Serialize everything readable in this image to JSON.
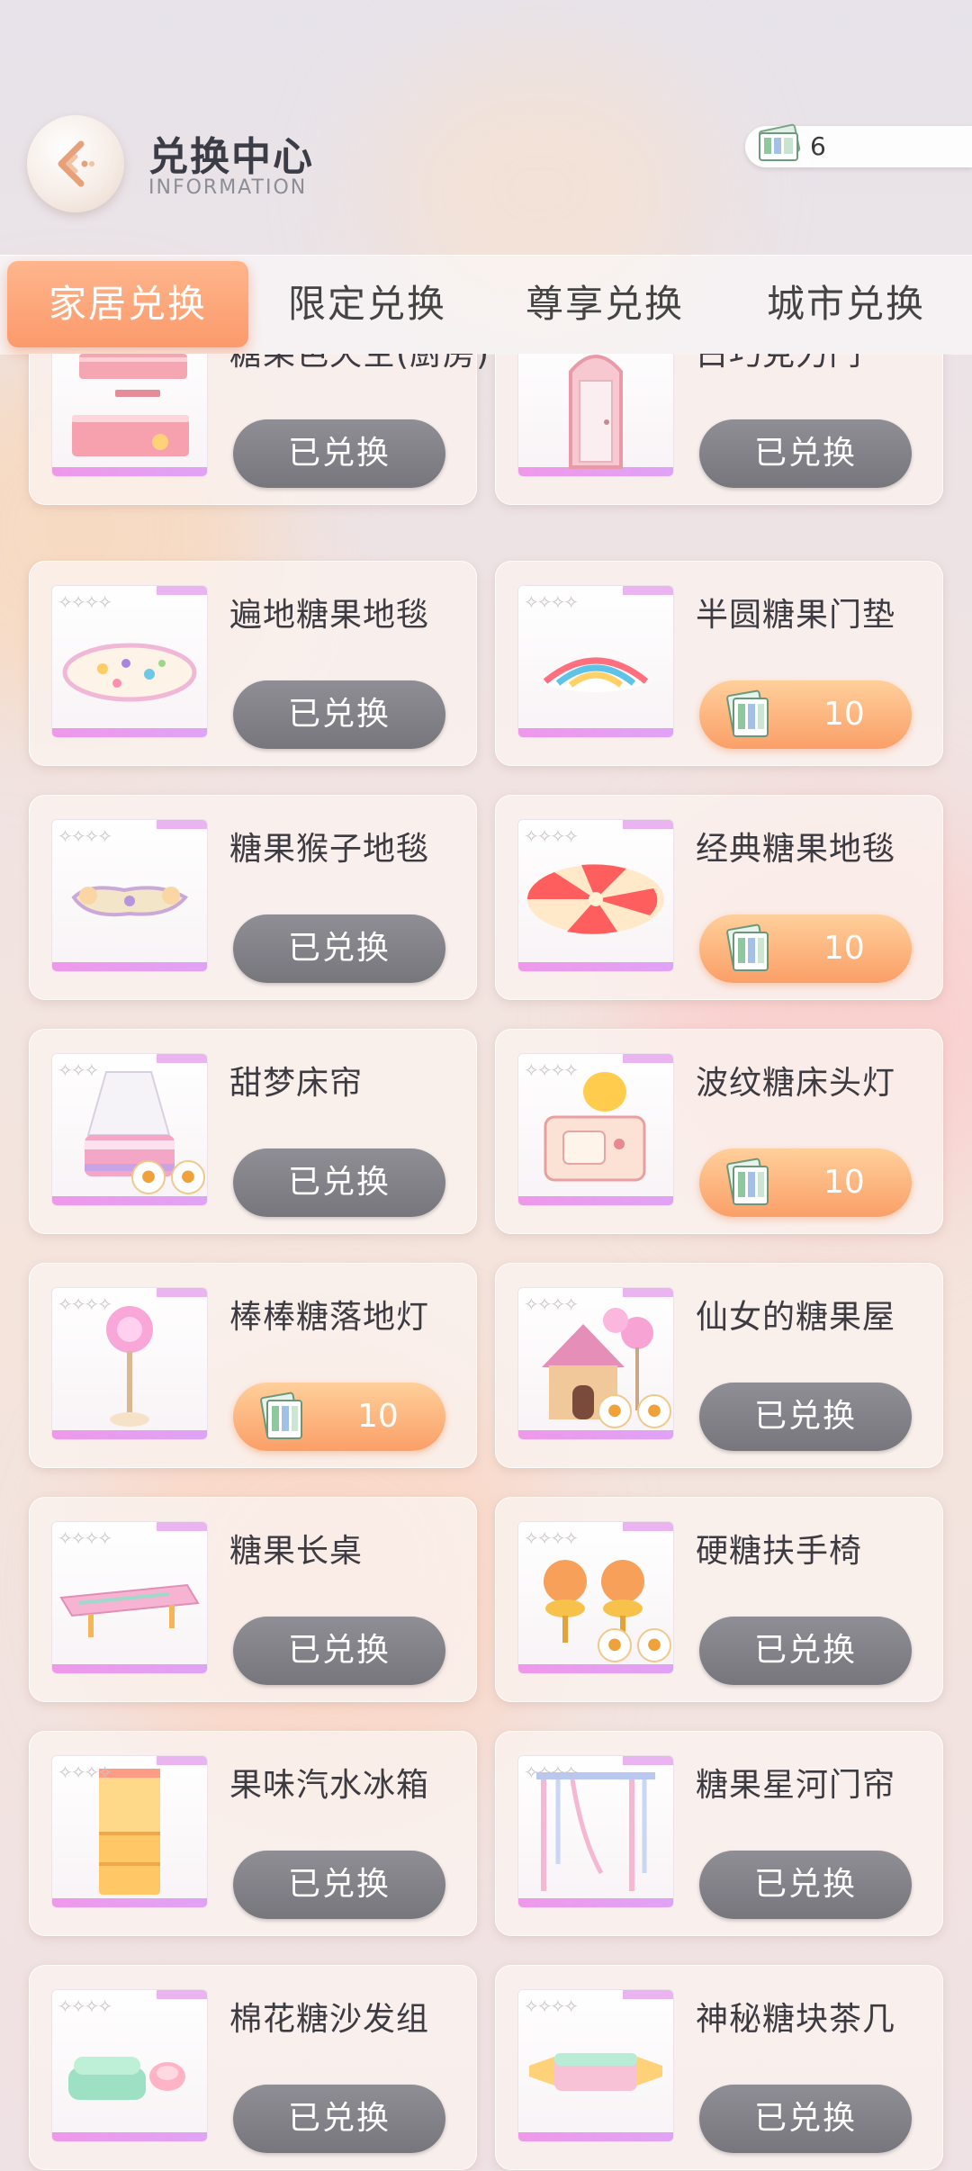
{
  "header": {
    "title": "兑换中心",
    "subtitle": "INFORMATION",
    "currency_amount": "6"
  },
  "tabs": [
    {
      "label": "家居兑换",
      "active": true
    },
    {
      "label": "限定兑换",
      "active": false
    },
    {
      "label": "尊享兑换",
      "active": false
    },
    {
      "label": "城市兑换",
      "active": false
    }
  ],
  "items": [
    {
      "name": "糖果色天空(厨房)",
      "state": "redeemed",
      "button": "已兑换",
      "icon": "kitchen-set-icon"
    },
    {
      "name": "白巧克力门",
      "state": "redeemed",
      "button": "已兑换",
      "icon": "door-icon"
    },
    {
      "name": "遍地糖果地毯",
      "state": "redeemed",
      "button": "已兑换",
      "icon": "candy-rug-icon"
    },
    {
      "name": "半圆糖果门垫",
      "state": "available",
      "price": "10",
      "icon": "half-circle-mat-icon"
    },
    {
      "name": "糖果猴子地毯",
      "state": "redeemed",
      "button": "已兑换",
      "icon": "monkey-rug-icon"
    },
    {
      "name": "经典糖果地毯",
      "state": "available",
      "price": "10",
      "icon": "swirl-rug-icon"
    },
    {
      "name": "甜梦床帘",
      "state": "redeemed",
      "button": "已兑换",
      "icon": "canopy-bed-icon",
      "badges": true
    },
    {
      "name": "波纹糖床头灯",
      "state": "available",
      "price": "10",
      "icon": "bedside-lamp-icon"
    },
    {
      "name": "棒棒糖落地灯",
      "state": "available",
      "price": "10",
      "icon": "lollipop-lamp-icon"
    },
    {
      "name": "仙女的糖果屋",
      "state": "redeemed",
      "button": "已兑换",
      "icon": "candy-house-icon",
      "badges": true
    },
    {
      "name": "糖果长桌",
      "state": "redeemed",
      "button": "已兑换",
      "icon": "long-table-icon"
    },
    {
      "name": "硬糖扶手椅",
      "state": "redeemed",
      "button": "已兑换",
      "icon": "armchair-icon",
      "badges": true
    },
    {
      "name": "果味汽水冰箱",
      "state": "redeemed",
      "button": "已兑换",
      "icon": "fridge-icon"
    },
    {
      "name": "糖果星河门帘",
      "state": "redeemed",
      "button": "已兑换",
      "icon": "curtain-icon"
    },
    {
      "name": "棉花糖沙发组",
      "state": "redeemed",
      "button": "已兑换",
      "icon": "sofa-icon"
    },
    {
      "name": "神秘糖块茶几",
      "state": "redeemed",
      "button": "已兑换",
      "icon": "tea-table-icon"
    }
  ],
  "colors": {
    "accent": "#fb9a6c",
    "redeemed_button": "#808087",
    "rarity_bar": "#ef98ea"
  }
}
